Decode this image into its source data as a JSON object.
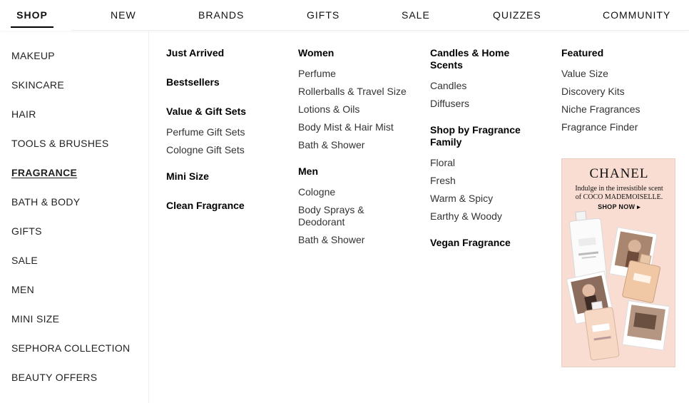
{
  "topnav": {
    "shop": "SHOP",
    "new": "NEW",
    "brands": "BRANDS",
    "gifts": "GIFTS",
    "sale": "SALE",
    "quizzes": "QUIZZES",
    "community": "COMMUNITY"
  },
  "categories": [
    "MAKEUP",
    "SKINCARE",
    "HAIR",
    "TOOLS & BRUSHES",
    "FRAGRANCE",
    "BATH & BODY",
    "GIFTS",
    "SALE",
    "MEN",
    "MINI SIZE",
    "SEPHORA COLLECTION",
    "BEAUTY OFFERS"
  ],
  "col1": {
    "just_arrived": "Just Arrived",
    "bestsellers": "Bestsellers",
    "value_gift_sets": "Value & Gift Sets",
    "value_links": [
      "Perfume Gift Sets",
      "Cologne Gift Sets"
    ],
    "mini_size": "Mini Size",
    "clean_fragrance": "Clean Fragrance"
  },
  "col2": {
    "women": "Women",
    "women_links": [
      "Perfume",
      "Rollerballs & Travel Size",
      "Lotions & Oils",
      "Body Mist & Hair Mist",
      "Bath & Shower"
    ],
    "men": "Men",
    "men_links": [
      "Cologne",
      "Body Sprays &",
      "Deodorant",
      "Bath & Shower"
    ]
  },
  "col3": {
    "candles_line1": "Candles & Home",
    "candles_line2": "Scents",
    "candles_links": [
      "Candles",
      "Diffusers"
    ],
    "family_line1": "Shop by Fragrance",
    "family_line2": "Family",
    "family_links": [
      "Floral",
      "Fresh",
      "Warm & Spicy",
      "Earthy & Woody"
    ],
    "vegan": "Vegan Fragrance"
  },
  "col4": {
    "featured": "Featured",
    "featured_links": [
      "Value Size",
      "Discovery Kits",
      "Niche Fragrances",
      "Fragrance Finder"
    ]
  },
  "ad": {
    "brand": "CHANEL",
    "line1": "Indulge in the irresistible scent",
    "line2": "of COCO MADEMOISELLE.",
    "cta": "SHOP NOW ▸",
    "bg_color": "#f9ddd2"
  }
}
